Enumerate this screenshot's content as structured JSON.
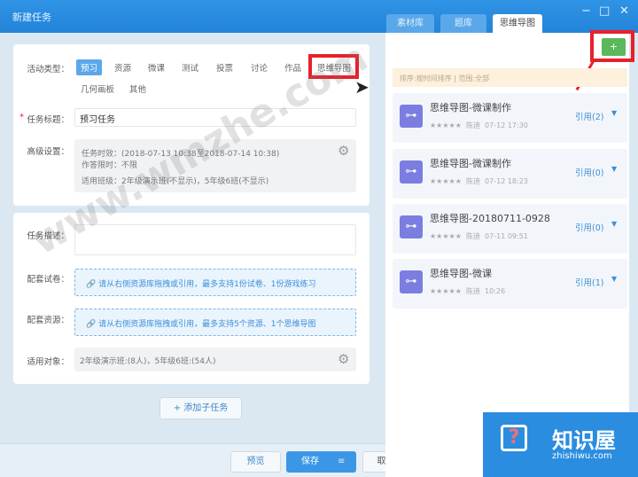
{
  "window": {
    "title": "新建任务",
    "minimize": "−",
    "maximize": "□",
    "close": "✕"
  },
  "right_tabs": [
    {
      "label": "素材库",
      "active": false
    },
    {
      "label": "题库",
      "active": false
    },
    {
      "label": "思维导图",
      "active": true
    }
  ],
  "form": {
    "activity_type_label": "活动类型：",
    "activity_types": [
      {
        "label": "预习",
        "selected": true
      },
      {
        "label": "资源"
      },
      {
        "label": "微课"
      },
      {
        "label": "测试"
      },
      {
        "label": "投票"
      },
      {
        "label": "讨论"
      },
      {
        "label": "作品"
      },
      {
        "label": "思维导图",
        "highlighted": true
      },
      {
        "label": "几何画板"
      },
      {
        "label": "其他"
      }
    ],
    "task_title_label": "任务标题：",
    "required_mark": "*",
    "task_title_value": "预习任务",
    "advanced_label": "高级设置：",
    "advanced_lines": [
      "任务时效：(2018-07-13 10:38至2018-07-14 10:38)",
      "作答限时：不限",
      "适用班级：2年级演示班(不显示)，5年级6班(不显示)"
    ],
    "desc_label": "任务描述：",
    "desc_value": "",
    "paper_label": "配套试卷：",
    "paper_hint": "请从右侧资源库拖拽或引用，最多支持1份试卷、1份游戏练习",
    "resource_label": "配套资源：",
    "resource_hint": "请从右侧资源库拖拽或引用，最多支持5个资源、1个思维导图",
    "target_label": "适用对象：",
    "target_value": "2年级演示班:(8人)，5年级6班:(54人)",
    "add_subtask": "+ 添加子任务"
  },
  "footer": {
    "preview": "预览",
    "save": "保存",
    "save_menu": "≡",
    "cancel": "取消"
  },
  "mindmap": {
    "add_button": "+",
    "sort_bar": "排序:按时间排序 | 范围:全部",
    "items": [
      {
        "title": "思维导图-微课制作",
        "stars": "★★★★★",
        "author": "陈迪",
        "time": "07-12 17:30",
        "ref": "引用(2)"
      },
      {
        "title": "思维导图-微课制作",
        "stars": "★★★★★",
        "author": "陈迪",
        "time": "07-12 18:23",
        "ref": "引用(0)"
      },
      {
        "title": "思维导图-20180711-0928",
        "stars": "★★★★★",
        "author": "陈迪",
        "time": "07-11 09:51",
        "ref": "引用(0)"
      },
      {
        "title": "思维导图-微课",
        "stars": "★★★★★",
        "author": "陈迪",
        "time": "10:26",
        "ref": "引用(1)"
      }
    ]
  },
  "watermark": {
    "site": "www.wmzhe.com",
    "brand": "知识屋",
    "brand_url": "zhishiwu.com"
  },
  "colors": {
    "titlebar": "#2a8de0",
    "accent": "#3d8fd6",
    "add_green": "#5cb85c",
    "highlight_red": "#e8202a",
    "mindmap_icon": "#7b7ee0"
  }
}
